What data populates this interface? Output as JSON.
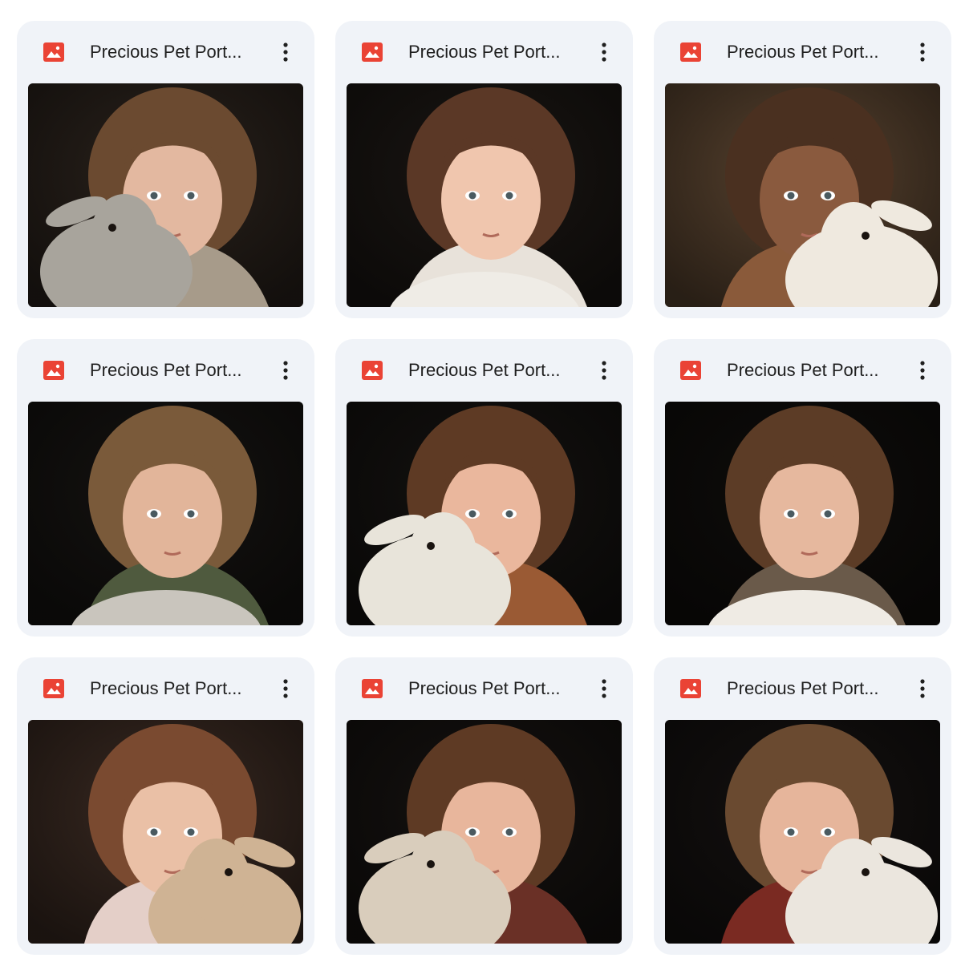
{
  "files": [
    {
      "title": "Precious Pet Port...",
      "icon": "image-file-icon",
      "menu_icon": "more-vert-icon",
      "thumbnail": {
        "bg": "#2a221c",
        "hair": "#6b4a30",
        "skin": "#e3b8a0",
        "cloth": "#a79b8a",
        "animal": "#a8a49c",
        "animal_side": "left"
      }
    },
    {
      "title": "Precious Pet Port...",
      "icon": "image-file-icon",
      "menu_icon": "more-vert-icon",
      "thumbnail": {
        "bg": "#1a1613",
        "hair": "#5b3826",
        "skin": "#f0c6ae",
        "cloth": "#e8e2da",
        "animal": "#efece6",
        "animal_side": "bottom"
      }
    },
    {
      "title": "Precious Pet Port...",
      "icon": "image-file-icon",
      "menu_icon": "more-vert-icon",
      "thumbnail": {
        "bg": "#5a4430",
        "hair": "#4a3020",
        "skin": "#8a5a3e",
        "cloth": "#8a5a3a",
        "animal": "#efe9df",
        "animal_side": "right"
      }
    },
    {
      "title": "Precious Pet Port...",
      "icon": "image-file-icon",
      "menu_icon": "more-vert-icon",
      "thumbnail": {
        "bg": "#151311",
        "hair": "#7a5a3a",
        "skin": "#e2b59a",
        "cloth": "#4f5a3e",
        "animal": "#c9c5bd",
        "animal_side": "bottom"
      }
    },
    {
      "title": "Precious Pet Port...",
      "icon": "image-file-icon",
      "menu_icon": "more-vert-icon",
      "thumbnail": {
        "bg": "#141210",
        "hair": "#5e3a24",
        "skin": "#eab79d",
        "cloth": "#9a5a34",
        "animal": "#e8e4da",
        "animal_side": "left"
      }
    },
    {
      "title": "Precious Pet Port...",
      "icon": "image-file-icon",
      "menu_icon": "more-vert-icon",
      "thumbnail": {
        "bg": "#0f0d0b",
        "hair": "#5c3c26",
        "skin": "#e6b89e",
        "cloth": "#6a5a4a",
        "animal": "#efebe4",
        "animal_side": "bottom"
      }
    },
    {
      "title": "Precious Pet Port...",
      "icon": "image-file-icon",
      "menu_icon": "more-vert-icon",
      "thumbnail": {
        "bg": "#3a2a22",
        "hair": "#7a4a30",
        "skin": "#eac0a6",
        "cloth": "#e4cfc8",
        "animal": "#cfb394",
        "animal_side": "right"
      }
    },
    {
      "title": "Precious Pet Port...",
      "icon": "image-file-icon",
      "menu_icon": "more-vert-icon",
      "thumbnail": {
        "bg": "#151210",
        "hair": "#5e3a24",
        "skin": "#e8b69c",
        "cloth": "#6a3026",
        "animal": "#d9cdbc",
        "animal_side": "left"
      }
    },
    {
      "title": "Precious Pet Port...",
      "icon": "image-file-icon",
      "menu_icon": "more-vert-icon",
      "thumbnail": {
        "bg": "#141110",
        "hair": "#6a4a30",
        "skin": "#e6b59b",
        "cloth": "#7a2a22",
        "animal": "#ebe6de",
        "animal_side": "right"
      }
    }
  ],
  "colors": {
    "card_bg": "#f0f3f8",
    "icon_red": "#ea4335",
    "title_text": "#1f1f1f",
    "menu_dots": "#1f1f1f"
  }
}
